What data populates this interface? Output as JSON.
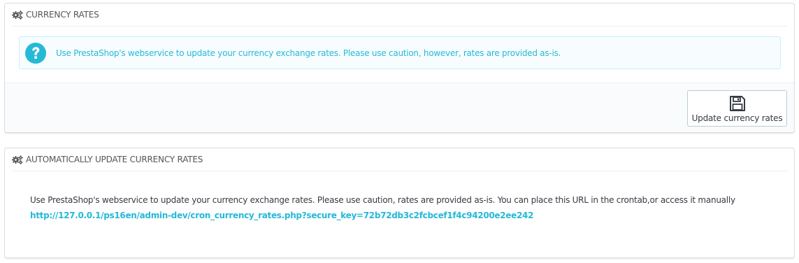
{
  "panels": {
    "currency_rates": {
      "title": "Currency rates",
      "icon": "cogs-icon",
      "alert": {
        "icon": "question-circle-icon",
        "text": "Use PrestaShop's webservice to update your currency exchange rates. Please use caution, however, rates are provided as-is."
      },
      "footer": {
        "button_label": "Update currency rates",
        "button_icon": "floppy-disk-icon"
      }
    },
    "auto_update": {
      "title": "Automatically update currency rates",
      "icon": "cogs-icon",
      "description": "Use PrestaShop's webservice to update your currency exchange rates. Please use caution, rates are provided as-is. You can place this URL in the crontab,or access it manually",
      "cron_url": "http://127.0.0.1/ps16en/admin-dev/cron_currency_rates.php?secure_key=72b72db3c2fcbcef1f4c94200e2ee242"
    }
  },
  "colors": {
    "accent": "#25b9d7",
    "alert_bg": "#f7fdff",
    "alert_border": "#c9eef7",
    "text": "#555555",
    "dark_text": "#363a41"
  }
}
